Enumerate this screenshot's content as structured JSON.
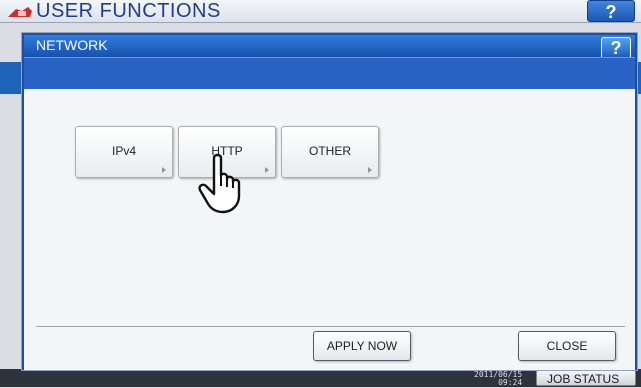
{
  "background": {
    "title": "USER FUNCTIONS",
    "help_label": "?",
    "datetime_line1": "2011/06/15",
    "datetime_line2": "09:24",
    "job_status_label": "JOB STATUS"
  },
  "dialog": {
    "title": "NETWORK",
    "help_label": "?",
    "tiles": [
      {
        "label": "IPv4"
      },
      {
        "label": "HTTP"
      },
      {
        "label": "OTHER"
      }
    ],
    "apply_now_label": "APPLY NOW",
    "close_label": "CLOSE"
  },
  "colors": {
    "titlebar": "#1f64bb",
    "accent": "#2a63c3"
  },
  "icons": [
    "machine-logo-icon",
    "help-icon",
    "pointing-hand-icon",
    "submenu-arrow-icon"
  ]
}
